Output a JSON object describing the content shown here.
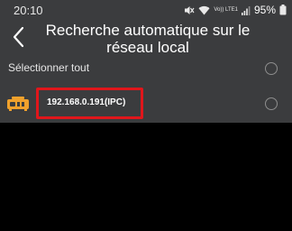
{
  "status_bar": {
    "time": "20:10",
    "volte_text": "Vo)) LTE1",
    "battery": "95%",
    "icons": [
      "mute-icon",
      "wifi-icon",
      "volte-icon",
      "signal-icon",
      "battery-icon"
    ]
  },
  "header": {
    "title": "Recherche automatique sur le réseau local",
    "back_icon": "back-chevron-icon"
  },
  "list": {
    "select_all_label": "Sélectionner tout",
    "devices": [
      {
        "label": "192.168.0.191(IPC)",
        "icon": "camera-device-icon",
        "selected": false
      }
    ]
  },
  "colors": {
    "header_bg": "#3b3c3e",
    "body_bg": "#000000",
    "device_icon": "#f0a12c",
    "highlight": "#e0161b"
  }
}
